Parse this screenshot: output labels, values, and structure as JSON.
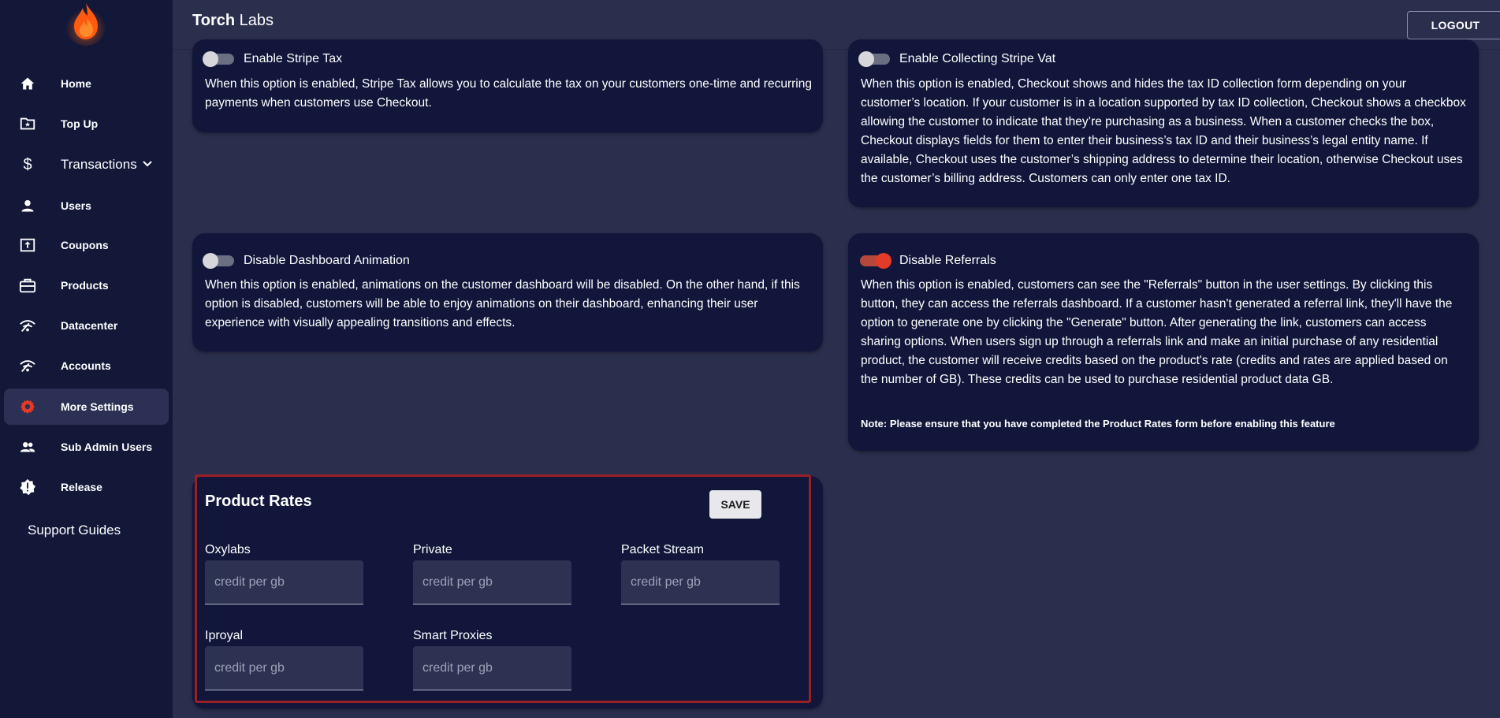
{
  "header": {
    "brand_bold": "Torch",
    "brand_rest": " Labs",
    "logout_label": "LOGOUT"
  },
  "sidebar": {
    "items": [
      {
        "label": "Home",
        "icon": "home-icon"
      },
      {
        "label": "Top Up",
        "icon": "folder-star-icon"
      },
      {
        "label": "Transactions",
        "icon": "dollar-icon"
      },
      {
        "label": "Users",
        "icon": "user-icon"
      },
      {
        "label": "Coupons",
        "icon": "upload-box-icon"
      },
      {
        "label": "Products",
        "icon": "briefcase-icon"
      },
      {
        "label": "Datacenter",
        "icon": "wifi-icon"
      },
      {
        "label": "Accounts",
        "icon": "wifi-icon"
      },
      {
        "label": "More Settings",
        "icon": "gear-icon",
        "active": true
      },
      {
        "label": "Sub Admin Users",
        "icon": "users-icon"
      },
      {
        "label": "Release",
        "icon": "badge-alert-icon"
      }
    ],
    "support_label": "Support Guides"
  },
  "settings": {
    "stripe_tax": {
      "label": "Enable Stripe Tax",
      "enabled": false,
      "description": "When this option is enabled, Stripe Tax allows you to calculate the tax on your customers one-time and recurring payments when customers use Checkout."
    },
    "stripe_vat": {
      "label": "Enable Collecting Stripe Vat",
      "enabled": false,
      "description": "When this option is enabled, Checkout shows and hides the tax ID collection form depending on your customer’s location. If your customer is in a location supported by tax ID collection, Checkout shows a checkbox allowing the customer to indicate that they’re purchasing as a business. When a customer checks the box, Checkout displays fields for them to enter their business’s tax ID and their business’s legal entity name. If available, Checkout uses the customer’s shipping address to determine their location, otherwise Checkout uses the customer’s billing address. Customers can only enter one tax ID."
    },
    "dashboard_animation": {
      "label": "Disable Dashboard Animation",
      "enabled": false,
      "description": "When this option is enabled, animations on the customer dashboard will be disabled. On the other hand, if this option is disabled, customers will be able to enjoy animations on their dashboard, enhancing their user experience with visually appealing transitions and effects."
    },
    "referrals": {
      "label": "Disable Referrals",
      "enabled": true,
      "description": "When this option is enabled, customers can see the \"Referrals\" button in the user settings. By clicking this button, they can access the referrals dashboard. If a customer hasn't generated a referral link, they'll have the option to generate one by clicking the \"Generate\" button. After generating the link, customers can access sharing options. When users sign up through a referrals link and make an initial purchase of any residential product, the customer will receive credits based on the product's rate (credits and rates are applied based on the number of GB). These credits can be used to purchase residential product data GB.",
      "note": "Note: Please ensure that you have completed the Product Rates form before enabling this feature"
    }
  },
  "product_rates": {
    "title": "Product Rates",
    "save_label": "SAVE",
    "fields": [
      {
        "label": "Oxylabs",
        "placeholder": "credit per gb",
        "value": ""
      },
      {
        "label": "Private",
        "placeholder": "credit per gb",
        "value": ""
      },
      {
        "label": "Packet Stream",
        "placeholder": "credit per gb",
        "value": ""
      },
      {
        "label": "Iproyal",
        "placeholder": "credit per gb",
        "value": ""
      },
      {
        "label": "Smart Proxies",
        "placeholder": "credit per gb",
        "value": ""
      }
    ]
  },
  "colors": {
    "sidebar_bg": "#131839",
    "page_bg": "#2b2f4e",
    "card_bg": "#11163a",
    "accent_red": "#e33b27",
    "highlight_border": "#9b2025"
  }
}
